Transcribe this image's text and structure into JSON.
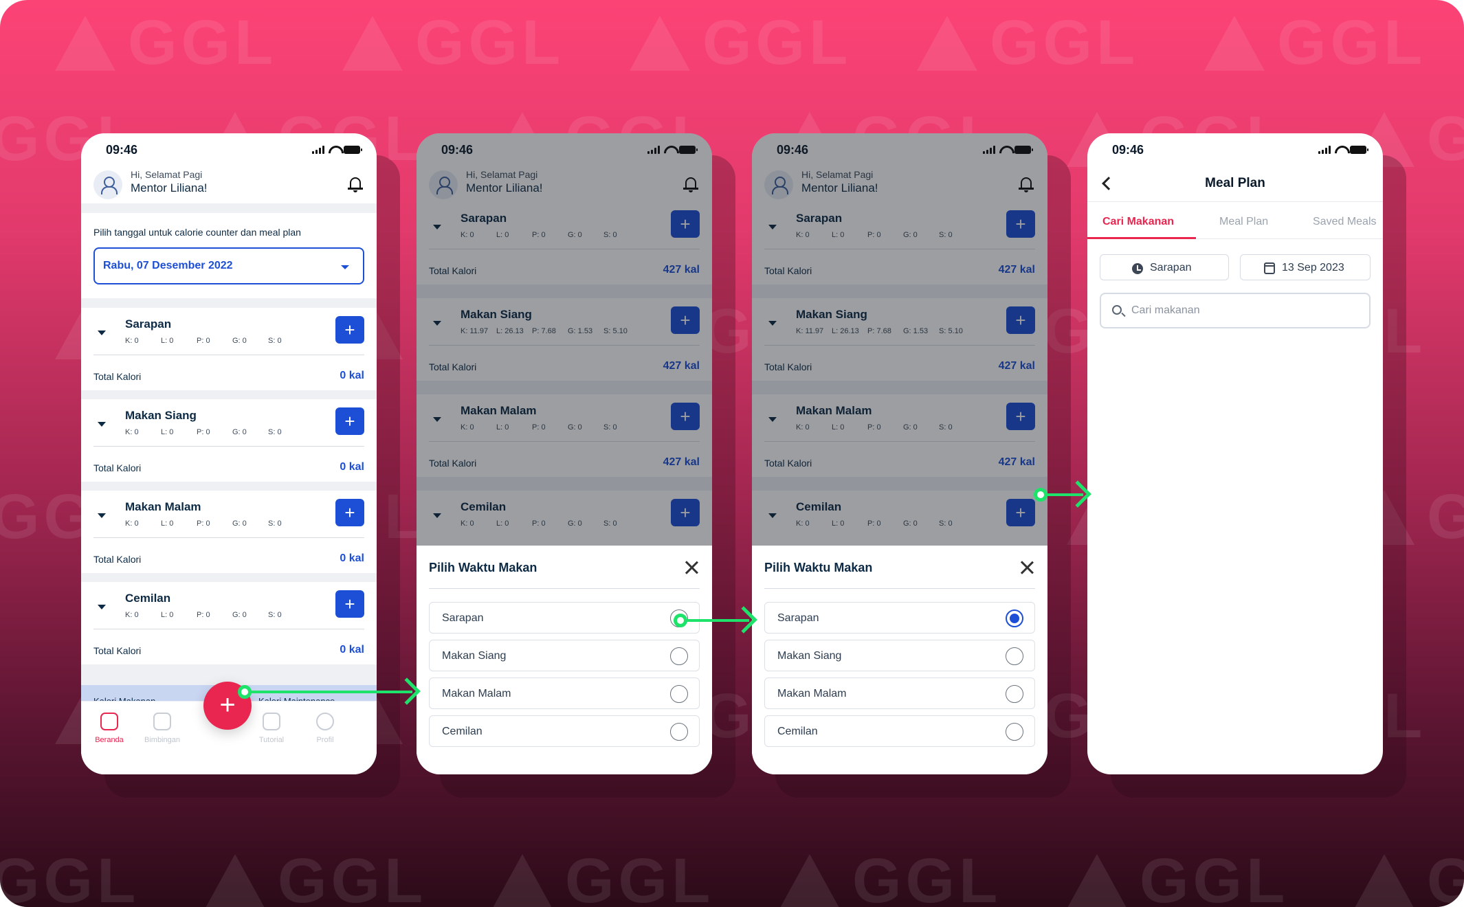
{
  "brand": {
    "watermark": "GGL",
    "colors": {
      "primary_blue": "#1d4fd6",
      "accent_red": "#e8264f",
      "flow_green": "#1de36b"
    }
  },
  "statusbar": {
    "time": "09:46"
  },
  "home": {
    "greeting_small": "Hi, Selamat Pagi",
    "greeting_name": "Mentor Liliana!",
    "date_label": "Pilih tanggal untuk calorie counter dan meal plan",
    "date_value": "Rabu, 07 Desember 2022",
    "total_label": "Total Kalori",
    "meals": [
      {
        "title": "Sarapan",
        "k": "K: 0",
        "l": "L: 0",
        "p": "P: 0",
        "g": "G: 0",
        "s": "S: 0",
        "total": "0 kal"
      },
      {
        "title": "Makan Siang",
        "k": "K: 0",
        "l": "L: 0",
        "p": "P: 0",
        "g": "G: 0",
        "s": "S: 0",
        "total": "0 kal"
      },
      {
        "title": "Makan Malam",
        "k": "K: 0",
        "l": "L: 0",
        "p": "P: 0",
        "g": "G: 0",
        "s": "S: 0",
        "total": "0 kal"
      },
      {
        "title": "Cemilan",
        "k": "K: 0",
        "l": "L: 0",
        "p": "P: 0",
        "g": "G: 0",
        "s": "S: 0",
        "total": "0 kal"
      }
    ],
    "strip_left": "Kalori Makanan",
    "strip_right": "Kalori Maintenance",
    "nav": [
      "Beranda",
      "Bimbingan",
      "Tutorial",
      "Profil"
    ],
    "fab": "+"
  },
  "picker": {
    "meals": [
      {
        "title": "Sarapan",
        "k": "K: 0",
        "l": "L: 0",
        "p": "P: 0",
        "g": "G: 0",
        "s": "S: 0",
        "total": "427 kal"
      },
      {
        "title": "Makan Siang",
        "k": "K: 11.97",
        "l": "L: 26.13",
        "p": "P: 7.68",
        "g": "G: 1.53",
        "s": "S: 5.10",
        "total": "427 kal"
      },
      {
        "title": "Makan Malam",
        "k": "K: 0",
        "l": "L: 0",
        "p": "P: 0",
        "g": "G: 0",
        "s": "S: 0",
        "total": "427 kal"
      },
      {
        "title": "Cemilan",
        "k": "K: 0",
        "l": "L: 0",
        "p": "P: 0",
        "g": "G: 0",
        "s": "S: 0"
      }
    ],
    "sheet_title": "Pilih Waktu Makan",
    "options": [
      "Sarapan",
      "Makan Siang",
      "Makan Malam",
      "Cemilan"
    ],
    "selected_in_step3": "Sarapan"
  },
  "mealplan": {
    "header": "Meal Plan",
    "tabs": [
      "Cari Makanan",
      "Meal Plan",
      "Saved Meals"
    ],
    "active_tab": "Cari Makanan",
    "chip_meal": "Sarapan",
    "chip_date": "13 Sep 2023",
    "search_placeholder": "Cari makanan"
  }
}
